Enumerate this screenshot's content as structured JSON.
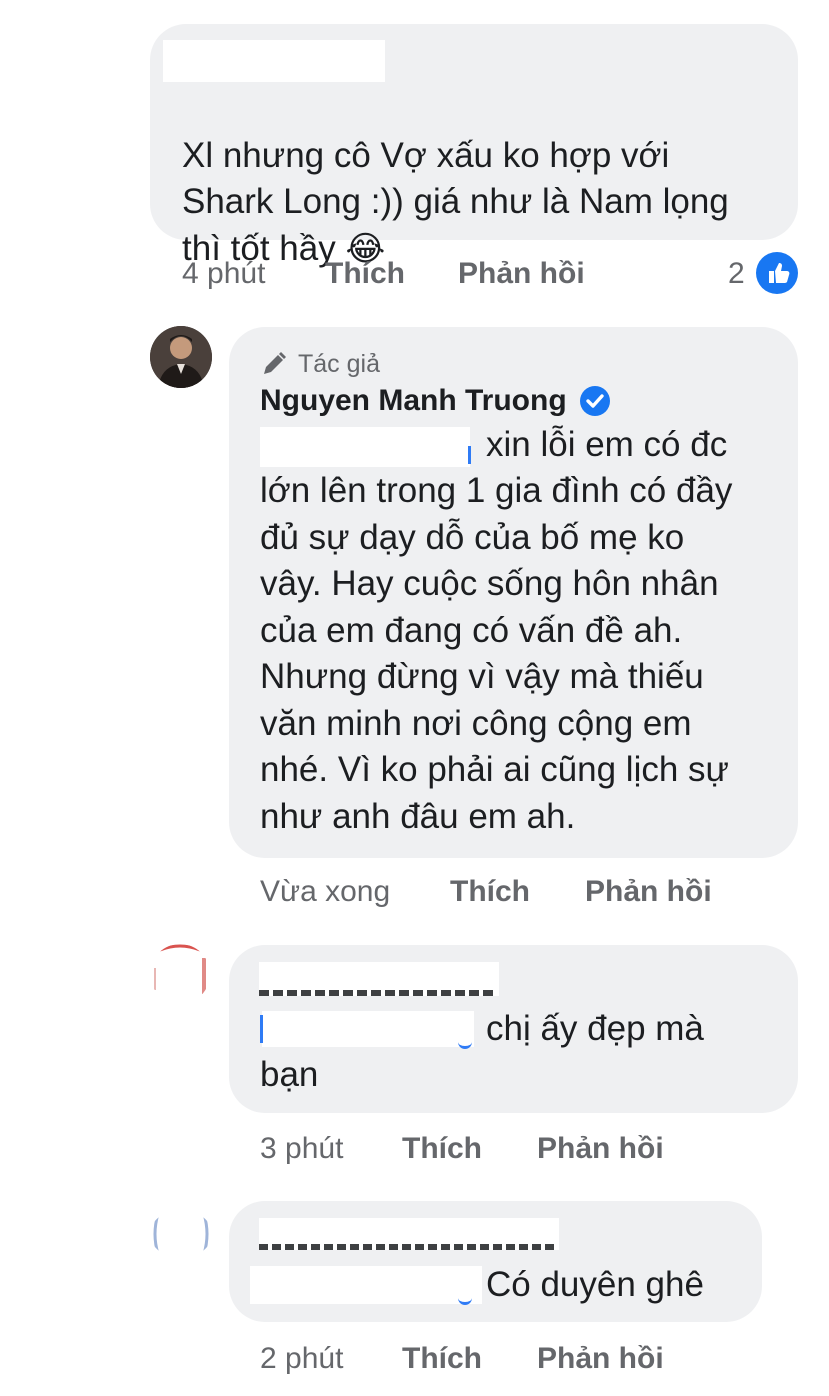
{
  "comments": [
    {
      "text": "Xl nhưng cô Vợ xấu ko hợp với\nShark Long  :)) giá như là Nam lọng\nthì tốt hầy",
      "emoji": "😂",
      "emoji_name": "face-with-tears-of-joy-icon",
      "time": "4 phút",
      "like_label": "Thích",
      "reply_label": "Phản hồi",
      "reaction_count": "2",
      "reaction_icon": "like-reaction-icon"
    },
    {
      "badge": "Tác giả",
      "badge_icon": "pencil-icon",
      "author": "Nguyen Manh Truong",
      "verified_icon": "verified-badge-icon",
      "text_first_line": "xin lỗi em có đc",
      "text_rest": "lớn lên trong 1 gia đình có đầy\nđủ sự dạy dỗ của bố mẹ ko\nvây. Hay cuộc sống hôn nhân\ncủa em đang có vấn đề ah.\nNhưng đừng vì vậy mà thiếu\nvăn minh nơi công cộng em\nnhé. Vì ko phải ai cũng lịch sự\nnhư anh đâu em ah.",
      "time": "Vừa xong",
      "like_label": "Thích",
      "reply_label": "Phản hồi"
    },
    {
      "text_first_line": "chị ấy đẹp mà",
      "text_rest": "bạn",
      "time": "3 phút",
      "like_label": "Thích",
      "reply_label": "Phản hồi"
    },
    {
      "text_first_line": "Có duyên ghê",
      "time": "2 phút",
      "like_label": "Thích",
      "reply_label": "Phản hồi"
    }
  ],
  "colors": {
    "bubble": "#eff0f2",
    "meta": "#65676b",
    "like_blue": "#1877f2"
  }
}
